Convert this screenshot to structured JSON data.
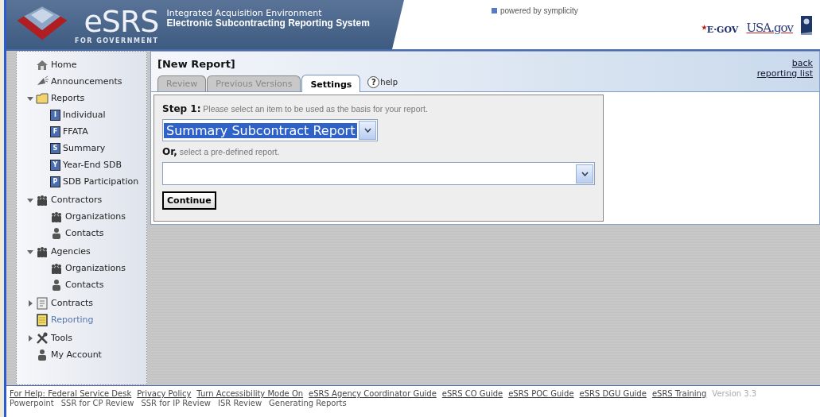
{
  "header": {
    "logo": "eSRS",
    "logo_sub": "FOR GOVERNMENT",
    "title_line1": "Integrated Acquisition Environment",
    "title_line2": "Electronic Subcontracting Reporting System",
    "powered_by": "powered by symplicity",
    "egov": "E·GOV",
    "usagov": "USA.gov"
  },
  "sidebar": {
    "items": [
      {
        "label": "Home",
        "selected": false
      },
      {
        "label": "Announcements",
        "selected": false
      },
      {
        "label": "Reports",
        "selected": false,
        "expanded": true,
        "children": [
          {
            "label": "Individual",
            "badge": "I",
            "selected": false
          },
          {
            "label": "FFATA",
            "badge": "F",
            "selected": false
          },
          {
            "label": "Summary",
            "badge": "S",
            "selected": false
          },
          {
            "label": "Year-End SDB",
            "badge": "Y",
            "selected": false
          },
          {
            "label": "SDB Participation",
            "badge": "P",
            "selected": false
          }
        ]
      },
      {
        "label": "Contractors",
        "selected": false,
        "expanded": true,
        "children": [
          {
            "label": "Organizations",
            "selected": false
          },
          {
            "label": "Contacts",
            "selected": false
          }
        ]
      },
      {
        "label": "Agencies",
        "selected": false,
        "expanded": true,
        "children": [
          {
            "label": "Organizations",
            "selected": false
          },
          {
            "label": "Contacts",
            "selected": false
          }
        ]
      },
      {
        "label": "Contracts",
        "selected": false,
        "expanded": false
      },
      {
        "label": "Reporting",
        "selected": true
      },
      {
        "label": "Tools",
        "selected": false,
        "expanded": false
      },
      {
        "label": "My Account",
        "selected": false
      }
    ]
  },
  "panel": {
    "title": "[New Report]",
    "links": [
      "back",
      "reporting list"
    ],
    "tabs": [
      {
        "label": "Review",
        "selected": false
      },
      {
        "label": "Previous Versions",
        "selected": false
      },
      {
        "label": "Settings",
        "selected": true
      }
    ],
    "help": {
      "icon": "?",
      "label": "help"
    },
    "form": {
      "step_label": "Step 1:",
      "step_text": "Please select an item to be used as the basis for your report.",
      "report_select": {
        "value": "Summary Subcontract Report"
      },
      "or_label": "Or,",
      "or_text": "select a pre-defined report.",
      "continue_button": "Continue"
    }
  },
  "footer": {
    "links": [
      "For Help: Federal Service Desk",
      "Privacy Policy",
      "Turn Accessibility Mode On",
      "eSRS Agency Coordinator Guide",
      "eSRS CO Guide",
      "eSRS POC Guide",
      "eSRS DGU Guide",
      "eSRS Training"
    ],
    "version": "Version 3.3",
    "line2": [
      "Powerpoint",
      "SSR for CP Review",
      "SSR for IP Review",
      "ISR Review",
      "Generating Reports"
    ]
  }
}
